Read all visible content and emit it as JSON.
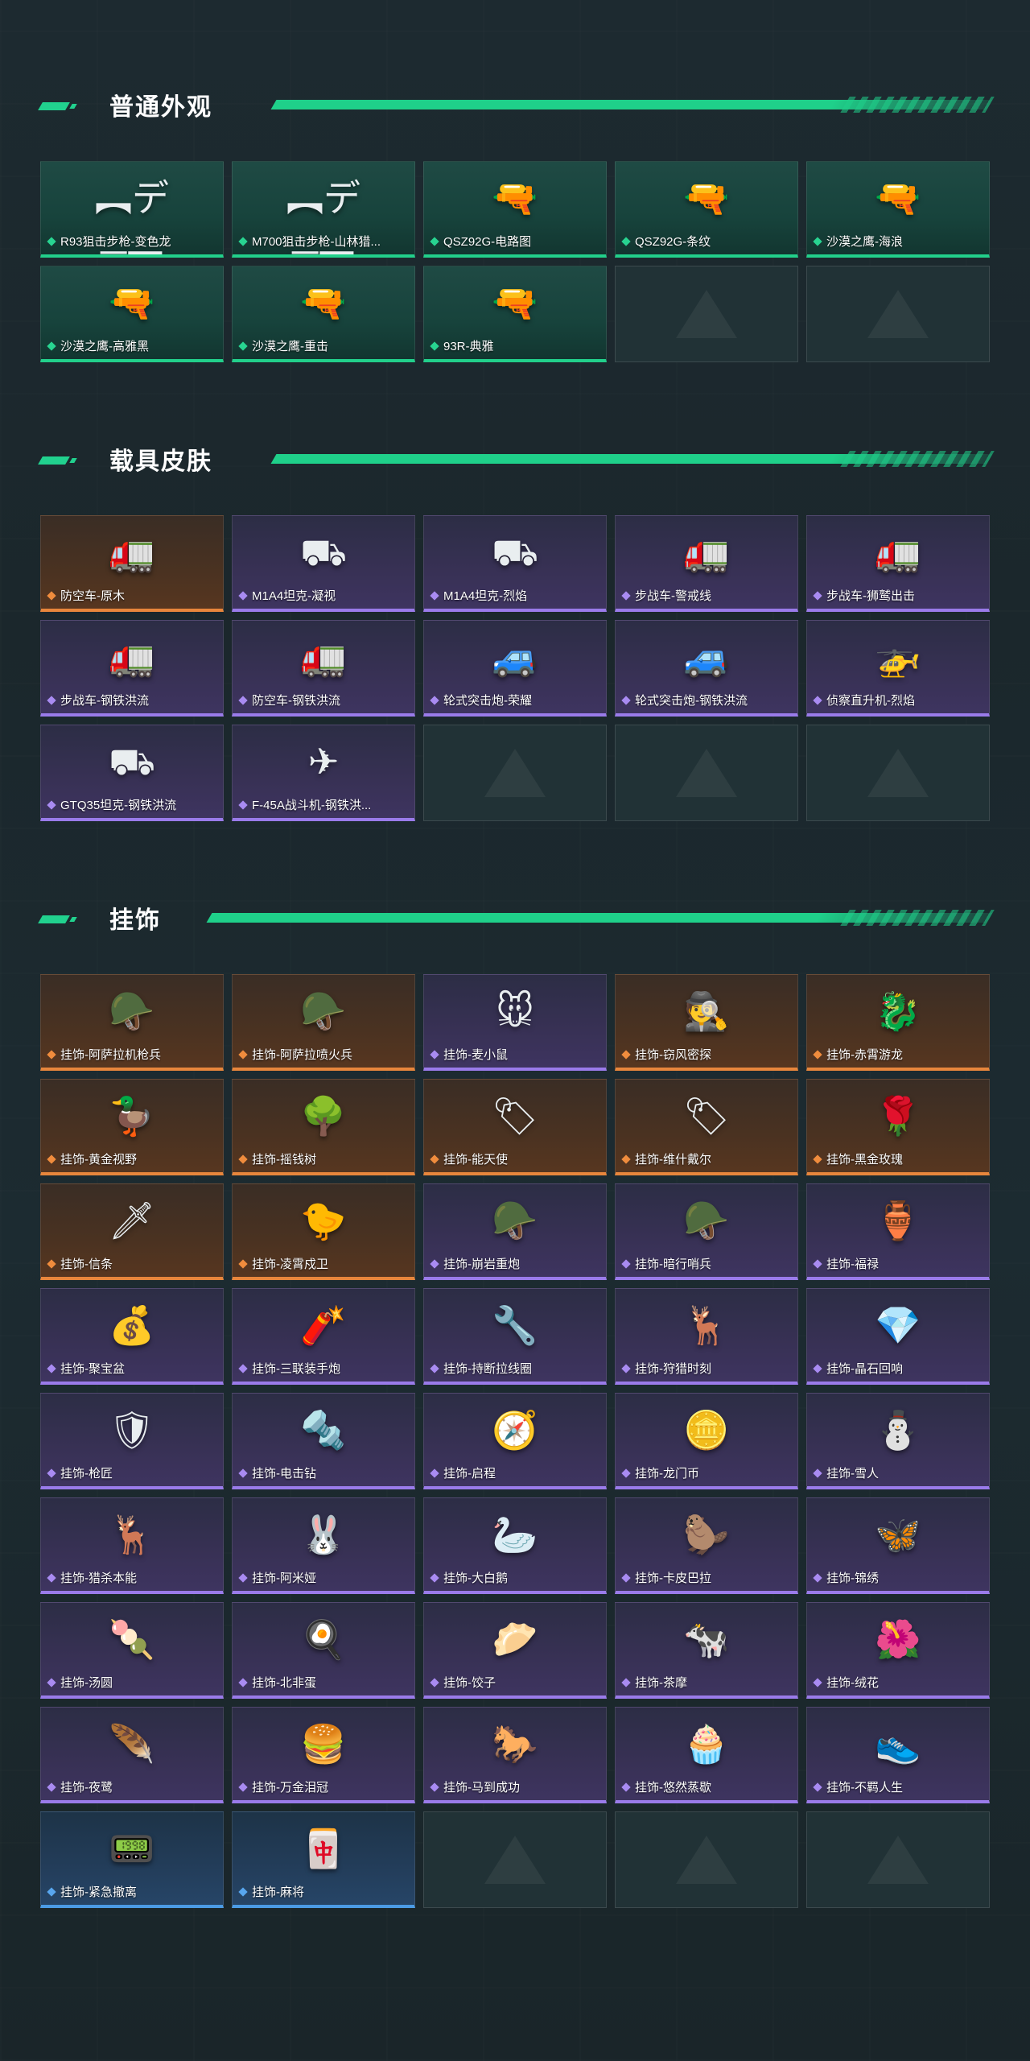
{
  "sections": [
    {
      "id": "common",
      "title": "普通外观",
      "items": [
        {
          "label": "R93狙击步枪-变色龙",
          "tier": "green",
          "icon": "sniper-rifle-icon",
          "glyph": "︻デ═一"
        },
        {
          "label": "M700狙击步枪-山林猎...",
          "tier": "green",
          "icon": "sniper-rifle-icon",
          "glyph": "︻デ═一"
        },
        {
          "label": "QSZ92G-电路图",
          "tier": "green",
          "icon": "pistol-icon",
          "glyph": "🔫"
        },
        {
          "label": "QSZ92G-条纹",
          "tier": "green",
          "icon": "pistol-icon",
          "glyph": "🔫"
        },
        {
          "label": "沙漠之鹰-海浪",
          "tier": "green",
          "icon": "pistol-icon",
          "glyph": "🔫"
        },
        {
          "label": "沙漠之鹰-高雅黑",
          "tier": "green",
          "icon": "pistol-icon",
          "glyph": "🔫"
        },
        {
          "label": "沙漠之鹰-重击",
          "tier": "green",
          "icon": "pistol-icon",
          "glyph": "🔫"
        },
        {
          "label": "93R-典雅",
          "tier": "green",
          "icon": "pistol-icon",
          "glyph": "🔫"
        },
        {
          "label": "",
          "tier": "empty",
          "icon": "placeholder-logo-icon",
          "glyph": ""
        },
        {
          "label": "",
          "tier": "empty",
          "icon": "placeholder-logo-icon",
          "glyph": ""
        }
      ]
    },
    {
      "id": "vehicle",
      "title": "载具皮肤",
      "items": [
        {
          "label": "防空车-原木",
          "tier": "orange",
          "icon": "armored-vehicle-icon",
          "glyph": "🚛"
        },
        {
          "label": "M1A4坦克-凝视",
          "tier": "purple",
          "icon": "tank-icon",
          "glyph": "⛟"
        },
        {
          "label": "M1A4坦克-烈焰",
          "tier": "purple",
          "icon": "tank-icon",
          "glyph": "⛟"
        },
        {
          "label": "步战车-警戒线",
          "tier": "purple",
          "icon": "armored-vehicle-icon",
          "glyph": "🚛"
        },
        {
          "label": "步战车-狮鹫出击",
          "tier": "purple",
          "icon": "armored-vehicle-icon",
          "glyph": "🚛"
        },
        {
          "label": "步战车-钢铁洪流",
          "tier": "purple",
          "icon": "armored-vehicle-icon",
          "glyph": "🚛"
        },
        {
          "label": "防空车-钢铁洪流",
          "tier": "purple",
          "icon": "armored-vehicle-icon",
          "glyph": "🚛"
        },
        {
          "label": "轮式突击炮-荣耀",
          "tier": "purple",
          "icon": "assault-vehicle-icon",
          "glyph": "🚙"
        },
        {
          "label": "轮式突击炮-钢铁洪流",
          "tier": "purple",
          "icon": "assault-vehicle-icon",
          "glyph": "🚙"
        },
        {
          "label": "侦察直升机-烈焰",
          "tier": "purple",
          "icon": "helicopter-icon",
          "glyph": "🚁"
        },
        {
          "label": "GTQ35坦克-钢铁洪流",
          "tier": "purple",
          "icon": "tank-icon",
          "glyph": "⛟"
        },
        {
          "label": "F-45A战斗机-钢铁洪...",
          "tier": "purple",
          "icon": "fighter-jet-icon",
          "glyph": "✈"
        },
        {
          "label": "",
          "tier": "empty",
          "icon": "placeholder-logo-icon",
          "glyph": ""
        },
        {
          "label": "",
          "tier": "empty",
          "icon": "placeholder-logo-icon",
          "glyph": ""
        },
        {
          "label": "",
          "tier": "empty",
          "icon": "placeholder-logo-icon",
          "glyph": ""
        }
      ]
    },
    {
      "id": "charm",
      "title": "挂饰",
      "items": [
        {
          "label": "挂饰-阿萨拉机枪兵",
          "tier": "orange",
          "icon": "soldier-charm-icon",
          "glyph": "🪖"
        },
        {
          "label": "挂饰-阿萨拉喷火兵",
          "tier": "orange",
          "icon": "soldier-charm-icon",
          "glyph": "🪖"
        },
        {
          "label": "挂饰-麦小鼠",
          "tier": "purple",
          "icon": "mouse-charm-icon",
          "glyph": "🐭"
        },
        {
          "label": "挂饰-窃风密探",
          "tier": "orange",
          "icon": "spy-charm-icon",
          "glyph": "🕵"
        },
        {
          "label": "挂饰-赤霄游龙",
          "tier": "orange",
          "icon": "dragon-charm-icon",
          "glyph": "🐉"
        },
        {
          "label": "挂饰-黄金视野",
          "tier": "orange",
          "icon": "duck-charm-icon",
          "glyph": "🦆"
        },
        {
          "label": "挂饰-摇钱树",
          "tier": "orange",
          "icon": "money-tree-charm-icon",
          "glyph": "🌳"
        },
        {
          "label": "挂饰-能天使",
          "tier": "orange",
          "icon": "card-charm-icon",
          "glyph": "🏷"
        },
        {
          "label": "挂饰-维什戴尔",
          "tier": "orange",
          "icon": "card-charm-icon",
          "glyph": "🏷"
        },
        {
          "label": "挂饰-黑金玫瑰",
          "tier": "orange",
          "icon": "rose-charm-icon",
          "glyph": "🌹"
        },
        {
          "label": "挂饰-信条",
          "tier": "orange",
          "icon": "blade-charm-icon",
          "glyph": "🗡"
        },
        {
          "label": "挂饰-凌霄戍卫",
          "tier": "orange",
          "icon": "bird-charm-icon",
          "glyph": "🐤"
        },
        {
          "label": "挂饰-崩岩重炮",
          "tier": "purple",
          "icon": "soldier-charm-icon",
          "glyph": "🪖"
        },
        {
          "label": "挂饰-暗行哨兵",
          "tier": "purple",
          "icon": "soldier-charm-icon",
          "glyph": "🪖"
        },
        {
          "label": "挂饰-福禄",
          "tier": "purple",
          "icon": "gourd-charm-icon",
          "glyph": "🏺"
        },
        {
          "label": "挂饰-聚宝盆",
          "tier": "purple",
          "icon": "treasure-bowl-charm-icon",
          "glyph": "💰"
        },
        {
          "label": "挂饰-三联装手炮",
          "tier": "purple",
          "icon": "launcher-charm-icon",
          "glyph": "🧨"
        },
        {
          "label": "挂饰-持断拉线圈",
          "tier": "purple",
          "icon": "tool-charm-icon",
          "glyph": "🔧"
        },
        {
          "label": "挂饰-狩猎时刻",
          "tier": "purple",
          "icon": "antler-charm-icon",
          "glyph": "🦌"
        },
        {
          "label": "挂饰-晶石回响",
          "tier": "purple",
          "icon": "crystal-charm-icon",
          "glyph": "💎"
        },
        {
          "label": "挂饰-枪匠",
          "tier": "purple",
          "icon": "badge-charm-icon",
          "glyph": "🛡"
        },
        {
          "label": "挂饰-电击钻",
          "tier": "purple",
          "icon": "drill-charm-icon",
          "glyph": "🔩"
        },
        {
          "label": "挂饰-启程",
          "tier": "purple",
          "icon": "compass-charm-icon",
          "glyph": "🧭"
        },
        {
          "label": "挂饰-龙门币",
          "tier": "purple",
          "icon": "coin-charm-icon",
          "glyph": "🪙"
        },
        {
          "label": "挂饰-雪人",
          "tier": "purple",
          "icon": "snowman-charm-icon",
          "glyph": "⛄"
        },
        {
          "label": "挂饰-猎杀本能",
          "tier": "purple",
          "icon": "antler-charm-icon",
          "glyph": "🦌"
        },
        {
          "label": "挂饰-阿米娅",
          "tier": "purple",
          "icon": "rabbit-charm-icon",
          "glyph": "🐰"
        },
        {
          "label": "挂饰-大白鹅",
          "tier": "purple",
          "icon": "goose-charm-icon",
          "glyph": "🦢"
        },
        {
          "label": "挂饰-卡皮巴拉",
          "tier": "purple",
          "icon": "capybara-charm-icon",
          "glyph": "🦫"
        },
        {
          "label": "挂饰-锦绣",
          "tier": "purple",
          "icon": "butterfly-charm-icon",
          "glyph": "🦋"
        },
        {
          "label": "挂饰-汤圆",
          "tier": "purple",
          "icon": "dumpling-charm-icon",
          "glyph": "🍡"
        },
        {
          "label": "挂饰-北非蛋",
          "tier": "purple",
          "icon": "egg-charm-icon",
          "glyph": "🍳"
        },
        {
          "label": "挂饰-饺子",
          "tier": "purple",
          "icon": "dumpling-charm-icon",
          "glyph": "🥟"
        },
        {
          "label": "挂饰-茶摩",
          "tier": "purple",
          "icon": "cow-charm-icon",
          "glyph": "🐄"
        },
        {
          "label": "挂饰-绒花",
          "tier": "purple",
          "icon": "flower-charm-icon",
          "glyph": "🌺"
        },
        {
          "label": "挂饰-夜鹭",
          "tier": "purple",
          "icon": "feather-charm-icon",
          "glyph": "🪶"
        },
        {
          "label": "挂饰-万金泪冠",
          "tier": "purple",
          "icon": "burger-charm-icon",
          "glyph": "🍔"
        },
        {
          "label": "挂饰-马到成功",
          "tier": "purple",
          "icon": "horse-charm-icon",
          "glyph": "🐎"
        },
        {
          "label": "挂饰-悠然蒸歇",
          "tier": "purple",
          "icon": "cupcake-charm-icon",
          "glyph": "🧁"
        },
        {
          "label": "挂饰-不羁人生",
          "tier": "purple",
          "icon": "sneaker-charm-icon",
          "glyph": "👟"
        },
        {
          "label": "挂饰-紧急撤离",
          "tier": "blue",
          "icon": "device-charm-icon",
          "glyph": "📟"
        },
        {
          "label": "挂饰-麻将",
          "tier": "blue",
          "icon": "mahjong-charm-icon",
          "glyph": "🀄"
        },
        {
          "label": "",
          "tier": "empty",
          "icon": "placeholder-logo-icon",
          "glyph": ""
        },
        {
          "label": "",
          "tier": "empty",
          "icon": "placeholder-logo-icon",
          "glyph": ""
        },
        {
          "label": "",
          "tier": "empty",
          "icon": "placeholder-logo-icon",
          "glyph": ""
        }
      ]
    }
  ],
  "colors": {
    "accent_green": "#22d08b",
    "tier_orange": "#e8863c",
    "tier_purple": "#9a7bea",
    "tier_blue": "#4b9be5",
    "background": "#1c2a30"
  }
}
